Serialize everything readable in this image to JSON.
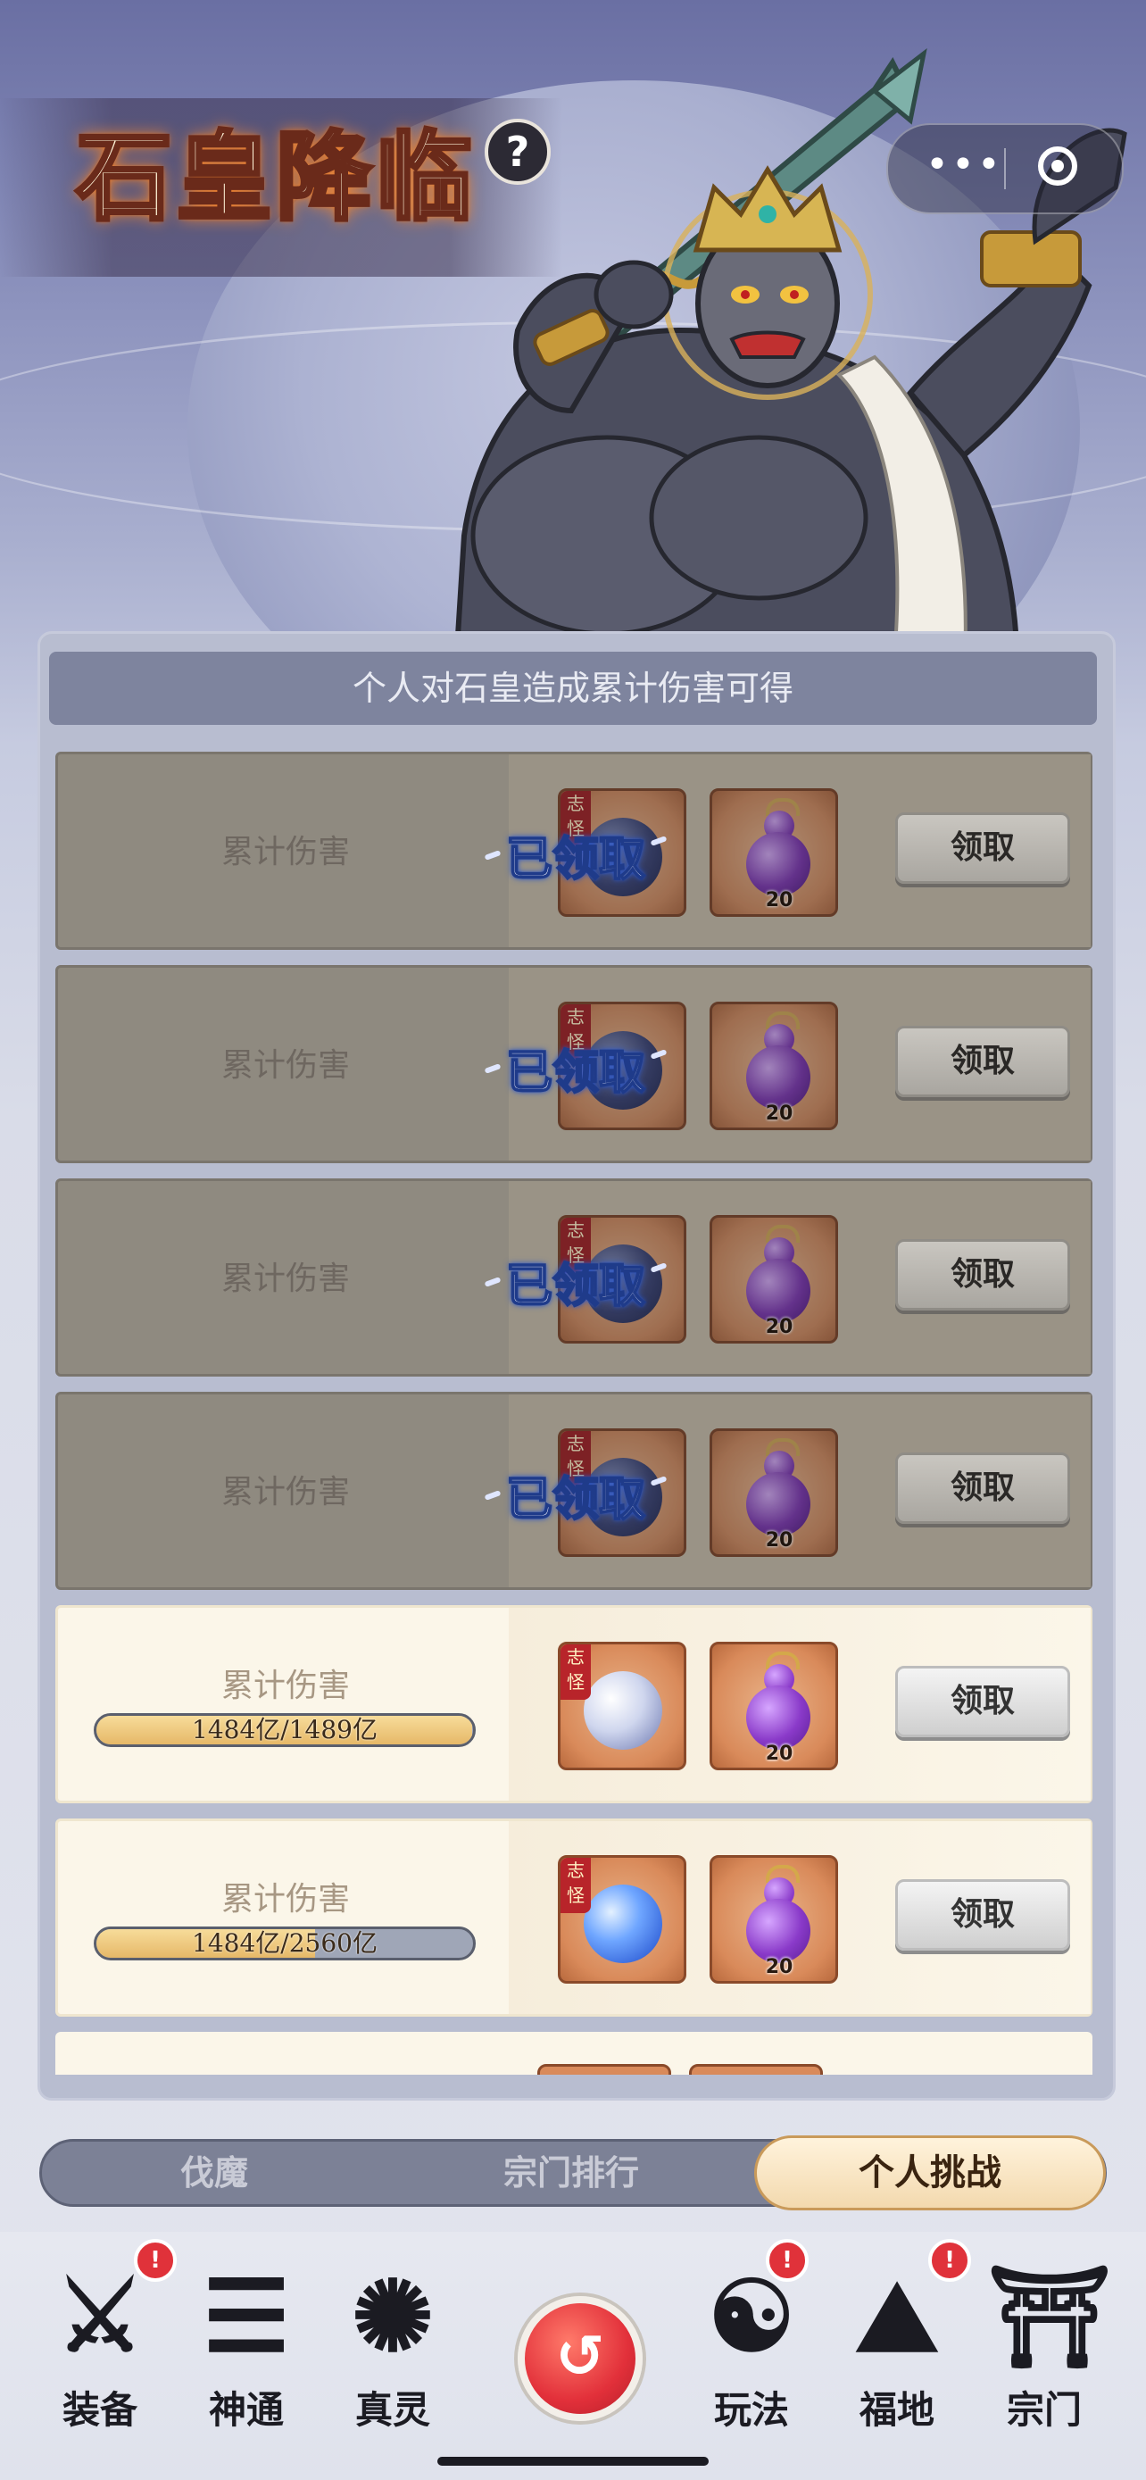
{
  "header": {
    "title": "石皇降临",
    "help_icon": "?"
  },
  "banner": {
    "text": "个人对石皇造成累计伤害可得"
  },
  "rows": [
    {
      "label": "累计伤害",
      "stamp": "已领取",
      "button": "领取",
      "qty": "20",
      "tag": "志怪"
    },
    {
      "label": "累计伤害",
      "stamp": "已领取",
      "button": "领取",
      "qty": "20",
      "tag": "志怪"
    },
    {
      "label": "累计伤害",
      "stamp": "已领取",
      "button": "领取",
      "qty": "20",
      "tag": "志怪"
    },
    {
      "label": "累计伤害",
      "stamp": "已领取",
      "button": "领取",
      "qty": "20",
      "tag": "志怪"
    },
    {
      "label": "累计伤害",
      "progress_text": "1484亿/1489亿",
      "progress": 0.997,
      "button": "领取",
      "qty": "20",
      "tag": "志怪"
    },
    {
      "label": "累计伤害",
      "progress_text": "1484亿/2560亿",
      "progress": 0.58,
      "button": "领取",
      "qty": "20",
      "tag": "志怪"
    }
  ],
  "tabs": [
    {
      "label": "伐魔"
    },
    {
      "label": "宗门排行"
    },
    {
      "label": "个人挑战",
      "active": true
    }
  ],
  "nav": [
    {
      "label": "装备",
      "icon": "equipment-icon",
      "badge": "!"
    },
    {
      "label": "神通",
      "icon": "scroll-icon"
    },
    {
      "label": "真灵",
      "icon": "spirit-icon"
    },
    {
      "label": "玩法",
      "icon": "gameplay-icon",
      "badge": "!"
    },
    {
      "label": "福地",
      "icon": "blessed-land-icon",
      "badge": "!"
    },
    {
      "label": "宗门",
      "icon": "sect-icon"
    }
  ],
  "colors": {
    "accent": "#e2303a",
    "active_tab": "#f3d9ae",
    "stamp_blue": "#1f3b8a"
  }
}
